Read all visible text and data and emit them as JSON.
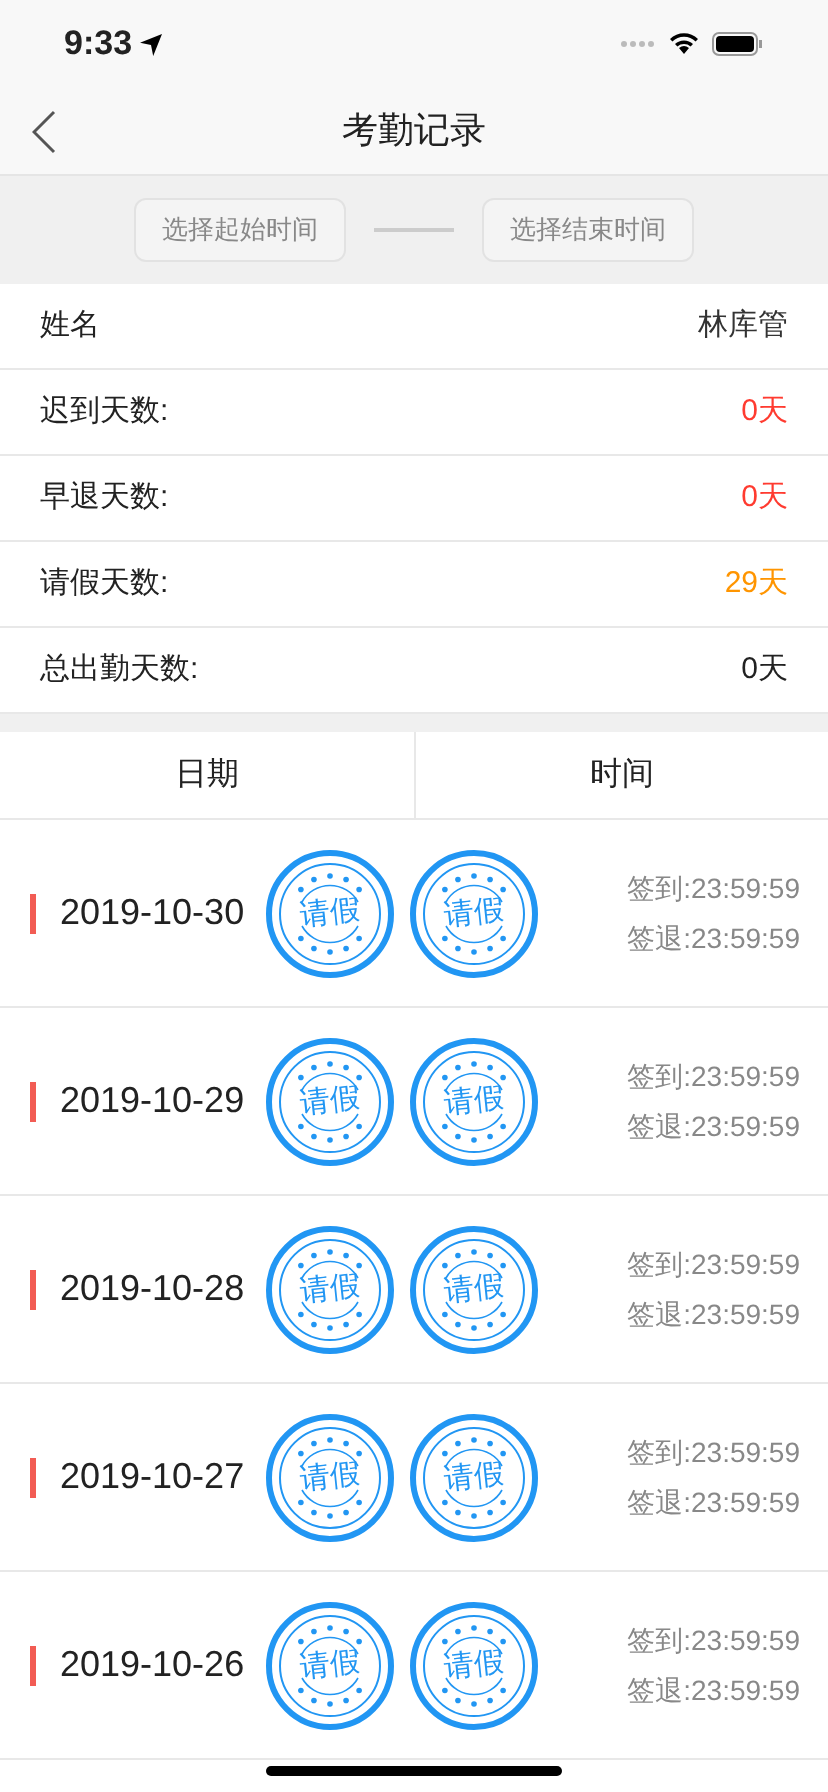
{
  "status_bar": {
    "time": "9:33"
  },
  "nav": {
    "title": "考勤记录"
  },
  "filter": {
    "start_placeholder": "选择起始时间",
    "end_placeholder": "选择结束时间"
  },
  "summary": [
    {
      "label": "姓名",
      "value": "林库管",
      "color": "#333333"
    },
    {
      "label": "迟到天数:",
      "value": "0天",
      "color": "#ff3b30"
    },
    {
      "label": "早退天数:",
      "value": "0天",
      "color": "#ff3b30"
    },
    {
      "label": "请假天数:",
      "value": "29天",
      "color": "#ff9500"
    },
    {
      "label": "总出勤天数:",
      "value": "0天",
      "color": "#222222"
    }
  ],
  "table": {
    "columns": [
      "日期",
      "时间"
    ],
    "rows": [
      {
        "date": "2019-10-30",
        "stamps": [
          "请假",
          "请假"
        ],
        "check_in": "签到:23:59:59",
        "check_out": "签退:23:59:59"
      },
      {
        "date": "2019-10-29",
        "stamps": [
          "请假",
          "请假"
        ],
        "check_in": "签到:23:59:59",
        "check_out": "签退:23:59:59"
      },
      {
        "date": "2019-10-28",
        "stamps": [
          "请假",
          "请假"
        ],
        "check_in": "签到:23:59:59",
        "check_out": "签退:23:59:59"
      },
      {
        "date": "2019-10-27",
        "stamps": [
          "请假",
          "请假"
        ],
        "check_in": "签到:23:59:59",
        "check_out": "签退:23:59:59"
      },
      {
        "date": "2019-10-26",
        "stamps": [
          "请假",
          "请假"
        ],
        "check_in": "签到:23:59:59",
        "check_out": "签退:23:59:59"
      }
    ]
  }
}
